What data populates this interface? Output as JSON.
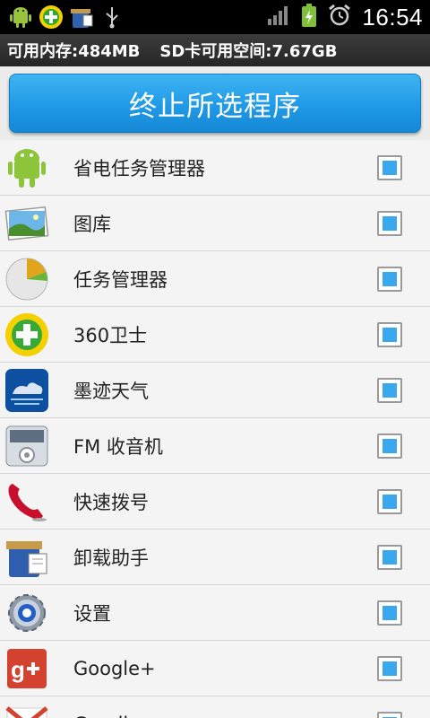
{
  "status_bar": {
    "icons": [
      "android-icon",
      "360-security-icon",
      "uninstall-helper-icon",
      "usb-icon"
    ],
    "right_icons": [
      "signal-icon",
      "battery-charging-icon",
      "alarm-icon"
    ],
    "time": "16:54"
  },
  "memory": {
    "ram_text": "可用内存:484MB",
    "sd_text": "SD卡可用空间:7.67GB"
  },
  "action": {
    "kill_label": "终止所选程序"
  },
  "apps": [
    {
      "label": "省电任务管理器",
      "icon": "android-icon",
      "checked": true
    },
    {
      "label": "图库",
      "icon": "gallery-icon",
      "checked": true
    },
    {
      "label": "任务管理器",
      "icon": "pie-chart-icon",
      "checked": true
    },
    {
      "label": "360卫士",
      "icon": "360-security-icon",
      "checked": true
    },
    {
      "label": "墨迹天气",
      "icon": "weather-icon",
      "checked": true
    },
    {
      "label": "FM 收音机",
      "icon": "radio-icon",
      "checked": true
    },
    {
      "label": "快速拨号",
      "icon": "phone-icon",
      "checked": true
    },
    {
      "label": "卸载助手",
      "icon": "uninstall-helper-icon",
      "checked": true
    },
    {
      "label": "设置",
      "icon": "settings-gear-icon",
      "checked": true
    },
    {
      "label": "Google+",
      "icon": "google-plus-icon",
      "checked": true
    },
    {
      "label": "Gmail",
      "icon": "gmail-icon",
      "checked": true
    }
  ],
  "colors": {
    "accent": "#1f9ae6",
    "checkbox_fill": "#3aa8ee",
    "status_bar": "#000000",
    "memory_bar": "#303030"
  }
}
